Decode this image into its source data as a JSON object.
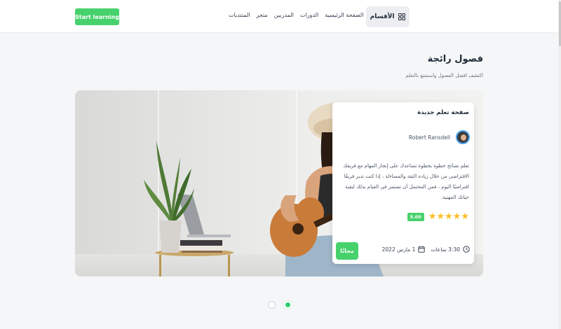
{
  "header": {
    "start_button": "Start learning",
    "nav": [
      "الصفحة الرئيسية",
      "الدورات",
      "المدربين",
      "متجر",
      "المنتديات"
    ],
    "categories_label": "الأقسام"
  },
  "section": {
    "title": "فصول رائجة",
    "subtitle": "اكتشف افضل الفصول واستمتع بالتعلم"
  },
  "course": {
    "title": "صفحة تعلم جديدة",
    "author": "Robert Ransdell",
    "description": "تعلم نصائح خطوة بخطوة تساعدك على إنجاز المهام مع فريقك الافتراضي من خلال زيادة الثقة والمساءلة ، إذا كنت تدير فريقًا افتراضيًا اليوم ، فمن المحتمل أن تستمر في القيام بذلك لبقية حياتك المهنية.",
    "rating": "5.00",
    "stars": "★★★★★",
    "date": "1 مارس 2022",
    "duration": "3:30 ساعات",
    "price_button": "مجانًا"
  },
  "carousel": {
    "pages": 2,
    "active_index": 1
  },
  "colors": {
    "accent_green": "#47d16c",
    "star": "#fbbf24",
    "avatar_ring": "#4aa3f0"
  }
}
